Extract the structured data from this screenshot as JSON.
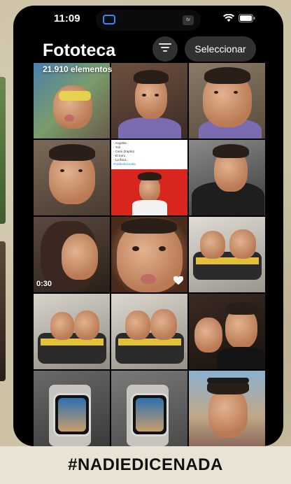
{
  "status_bar": {
    "time": "11:09",
    "island_badge": "tv"
  },
  "header": {
    "title": "Fototeca",
    "count": "21.910 elementos",
    "select_label": "Seleccionar"
  },
  "grid": {
    "notes_lines": [
      "- Angelita",
      "- Yuli",
      "- Cami (trapito)",
      "- El turro",
      "- La flaca"
    ],
    "notes_tag": "#nadiedicenada",
    "video_duration": "0:30"
  },
  "footer": {
    "hashtag": "#NADIEDICENADA"
  },
  "colors": {
    "accent": "#2b8cff",
    "background": "#cdc2a6",
    "heart": "#ffffff"
  }
}
